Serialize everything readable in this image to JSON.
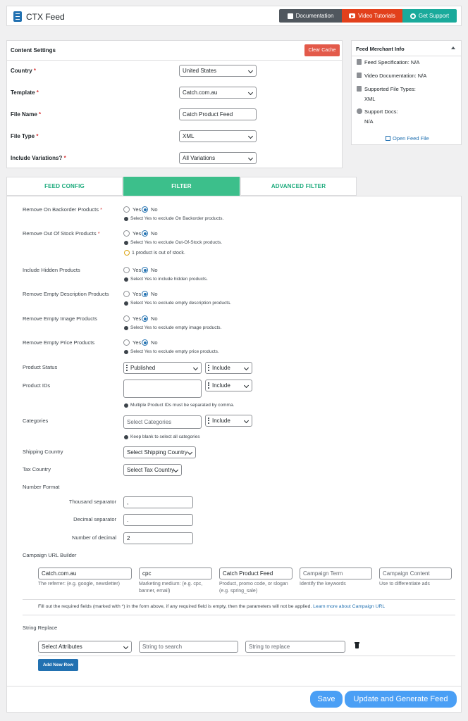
{
  "header": {
    "app_title": "CTX Feed",
    "buttons": {
      "documentation": "Documentation",
      "video": "Video Tutorials",
      "support": "Get Support"
    }
  },
  "content_settings": {
    "title": "Content Settings",
    "clear_cache": "Clear Cache",
    "fields": [
      {
        "label": "Country",
        "value": "United States"
      },
      {
        "label": "Template",
        "value": "Catch.com.au"
      },
      {
        "label": "File Name",
        "value": "Catch Product Feed"
      },
      {
        "label": "File Type",
        "value": "XML"
      },
      {
        "label": "Include Variations?",
        "value": "All Variations"
      }
    ],
    "required_mark": "*"
  },
  "merchant_info": {
    "title": "Feed Merchant Info",
    "spec": "Feed Specification: N/A",
    "video": "Video Documentation: N/A",
    "types_label": "Supported File Types:",
    "types_value": "XML",
    "docs_label": "Support Docs:",
    "docs_value": "N/A",
    "open_link": "Open Feed File"
  },
  "tabs": {
    "config": "FEED CONFIG",
    "filter": "FILTER",
    "advanced": "ADVANCED FILTER"
  },
  "filters": {
    "yes": "Yes",
    "no": "No",
    "backorder": {
      "label": "Remove On Backorder Products",
      "hint": "Select Yes to exclude On Backorder products."
    },
    "out_of_stock": {
      "label": "Remove Out Of Stock Products",
      "hint": "Select Yes to exclude Out-Of-Stock products.",
      "warning": "1 product is out of stock."
    },
    "hidden": {
      "label": "Include Hidden Products",
      "hint": "Select Yes to include hidden products."
    },
    "empty_desc": {
      "label": "Remove Empty Description Products",
      "hint": "Select Yes to exclude empty description products."
    },
    "empty_image": {
      "label": "Remove Empty Image Products",
      "hint": "Select Yes to exclude empty image products."
    },
    "empty_price": {
      "label": "Remove Empty Price Products",
      "hint": "Select Yes to exclude empty price products."
    },
    "status": {
      "label": "Product Status",
      "value": "Published",
      "mode": "Include"
    },
    "ids": {
      "label": "Product IDs",
      "mode": "Include",
      "hint": "Multiple Product IDs must be separated by comma."
    },
    "categories": {
      "label": "Categories",
      "placeholder": "Select Categories",
      "mode": "Include",
      "hint": "Keep blank to select all categories"
    },
    "shipping": {
      "label": "Shipping Country",
      "value": "Select Shipping Country"
    },
    "tax": {
      "label": "Tax Country",
      "value": "Select Tax Country"
    },
    "number_format": {
      "label": "Number Format",
      "thousand_label": "Thousand separator",
      "thousand_value": ",",
      "decimal_label": "Decimal separator",
      "decimal_value": ".",
      "decimals_label": "Number of decimal",
      "decimals_value": "2"
    },
    "campaign": {
      "label": "Campaign URL Builder",
      "source": {
        "value": "Catch.com.au",
        "caption": "The referrer: (e.g. google, newsletter)"
      },
      "medium": {
        "value": "cpc",
        "caption1": "Marketing medium: (e.g. cpc,",
        "caption2": "banner, email)"
      },
      "name": {
        "value": "Catch Product Feed",
        "caption1": "Product, promo code, or slogan",
        "caption2": "(e.g. spring_sale)"
      },
      "term": {
        "placeholder": "Campaign Term",
        "caption": "Identify the keywords"
      },
      "content": {
        "placeholder": "Campaign Content",
        "caption": "Use to differentiate ads"
      },
      "note": "Fill out the required fields (marked with *) in the form above, if any required field is empty, then the parameters will not be applied.",
      "note_link": "Learn more about Campaign URL"
    },
    "string_replace": {
      "label": "String Replace",
      "attr": "Select Attributes",
      "search_ph": "String to search",
      "replace_ph": "String to replace",
      "add_row": "Add New Row"
    }
  },
  "footer": {
    "save": "Save",
    "update": "Update and Generate Feed"
  }
}
